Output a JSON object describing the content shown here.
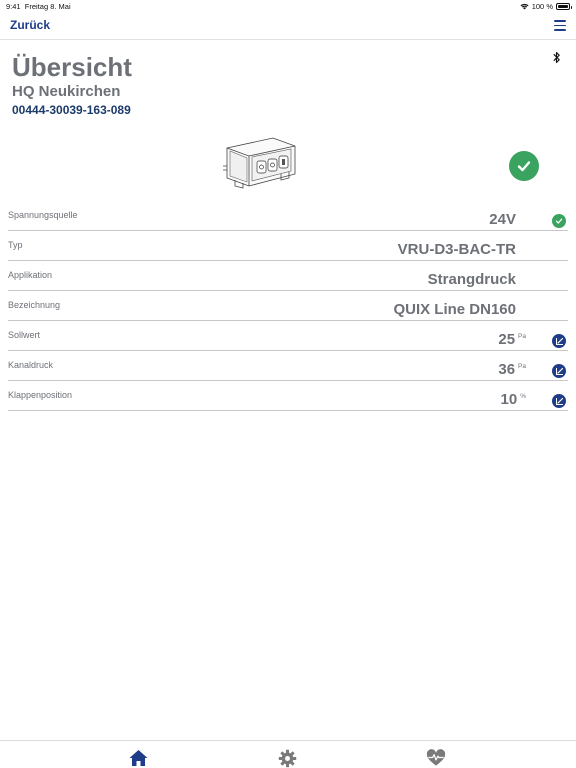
{
  "status_bar": {
    "time": "9:41",
    "date": "Freitag 8. Mai",
    "battery": "100 %"
  },
  "nav": {
    "back_label": "Zurück",
    "menu_icon": "hamburger-icon"
  },
  "header": {
    "title": "Übersicht",
    "subtitle": "HQ Neukirchen",
    "serial": "00444-30039-163-089",
    "bluetooth_icon": "bluetooth-icon"
  },
  "device_status": {
    "icon": "check-circle-icon",
    "color": "#3aa35f"
  },
  "rows": [
    {
      "label": "Spannungsquelle",
      "value": "24V",
      "unit": "",
      "icon": "check-circle-icon"
    },
    {
      "label": "Typ",
      "value": "VRU-D3-BAC-TR",
      "unit": ""
    },
    {
      "label": "Applikation",
      "value": "Strangdruck",
      "unit": ""
    },
    {
      "label": "Bezeichnung",
      "value": "QUIX Line DN160",
      "unit": ""
    },
    {
      "label": "Sollwert",
      "value": "25",
      "unit": "Pa",
      "icon": "edit-chart-icon"
    },
    {
      "label": "Kanaldruck",
      "value": "36",
      "unit": "Pa",
      "icon": "edit-chart-icon"
    },
    {
      "label": "Klappenposition",
      "value": "10",
      "unit": "%",
      "icon": "edit-chart-icon"
    }
  ],
  "tabs": [
    {
      "name": "home",
      "icon": "home-icon",
      "active": true
    },
    {
      "name": "settings",
      "icon": "gear-icon",
      "active": false
    },
    {
      "name": "health",
      "icon": "heart-pulse-icon",
      "active": false
    }
  ],
  "colors": {
    "accent": "#1f3c88",
    "success": "#3aa35f",
    "text_gray": "#6d7177"
  }
}
